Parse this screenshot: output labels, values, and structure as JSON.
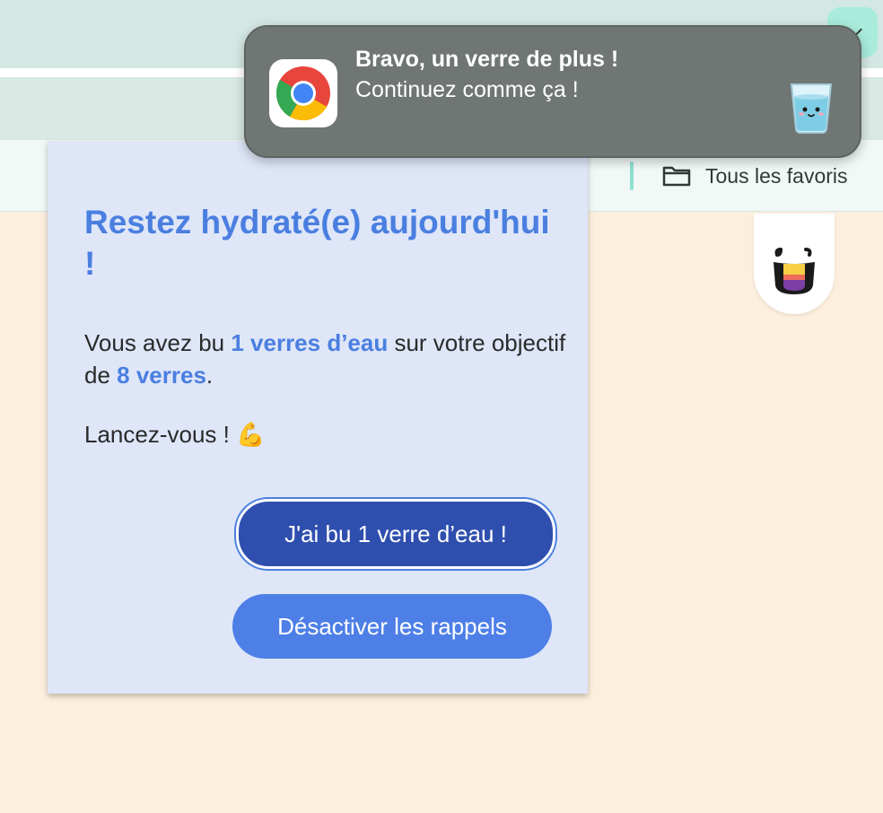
{
  "browser": {
    "bookmarks_all_label": "Tous les favoris"
  },
  "notification": {
    "title": "Bravo, un verre de plus !",
    "body": "Continuez comme ça !",
    "app_icon": "chrome-logo-icon",
    "image": "glass-of-water-icon"
  },
  "popup": {
    "title": "Restez hydraté(e) aujourd'hui !",
    "progress_prefix": "Vous avez bu ",
    "glasses_drunk": "1 verres d’eau",
    "progress_middle": " sur votre objectif de ",
    "goal": "8 verres",
    "progress_suffix": ".",
    "encouragement": "Lancez-vous ! 💪",
    "drank_button_label": "J'ai bu 1 verre d’eau !",
    "disable_button_label": "Désactiver les rappels"
  },
  "colors": {
    "accent": "#4a7fe0",
    "primary_button": "#2f4faf",
    "secondary_button": "#4d7fe7",
    "popup_background": "#dee6f8",
    "page_background": "#fcefde"
  }
}
